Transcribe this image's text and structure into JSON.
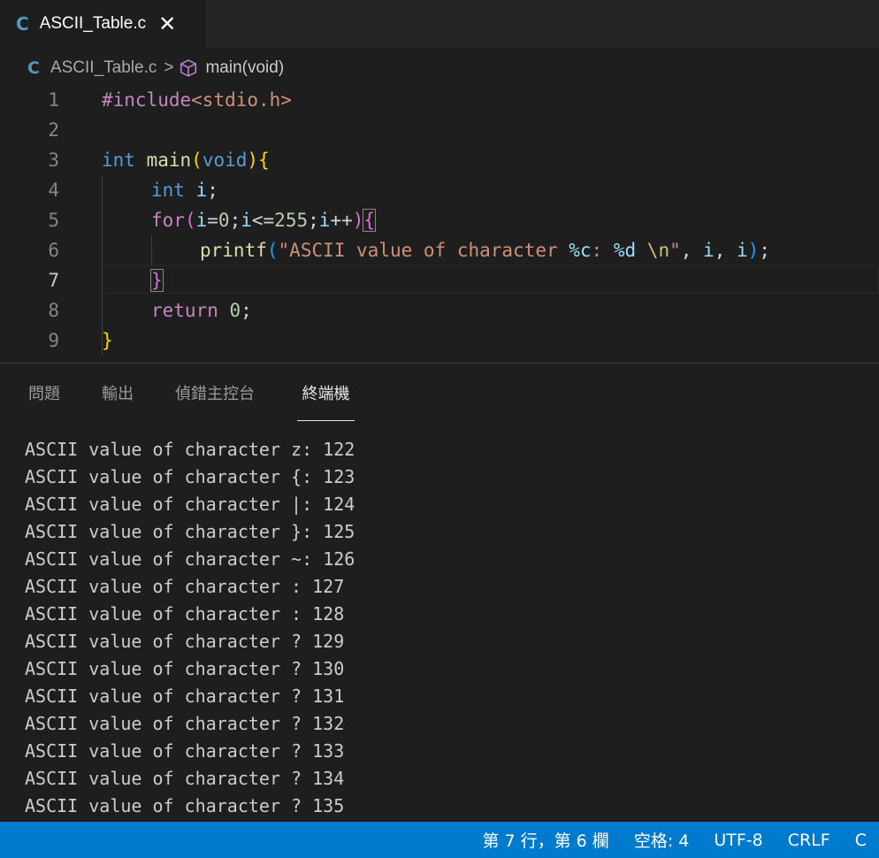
{
  "tab": {
    "title": "ASCII_Table.c",
    "icon": "C",
    "close_glyph": "✕"
  },
  "breadcrumb": {
    "icon": "C",
    "file": "ASCII_Table.c",
    "separator": ">",
    "function": "main(void)"
  },
  "editor": {
    "line_numbers": [
      "1",
      "2",
      "3",
      "4",
      "5",
      "6",
      "7",
      "8",
      "9"
    ],
    "active_line": "7"
  },
  "code": {
    "l1": {
      "directive": "#include",
      "header": "<stdio.h>"
    },
    "l3": {
      "type": "int",
      "name": "main",
      "open": "(",
      "param": "void",
      "close": ")",
      "brace": "{"
    },
    "l4": {
      "type": "int",
      "var": "i",
      "semi": ";"
    },
    "l5": {
      "kw": "for",
      "open": "(",
      "i1": "i",
      "op1": "=",
      "n1": "0",
      "s1": ";",
      "i2": "i",
      "op2": "<=",
      "n2": "255",
      "s2": ";",
      "i3": "i",
      "op3": "++",
      "close": ")",
      "brace": "{"
    },
    "l6": {
      "fn": "printf",
      "open": "(",
      "q1": "\"",
      "text": "ASCII value of character ",
      "f1": "%c",
      "colon": ": ",
      "f2": "%d",
      "space": " ",
      "esc": "\\n",
      "q2": "\"",
      "comma1": ", ",
      "a1": "i",
      "comma2": ", ",
      "a2": "i",
      "close": ")",
      "semi": ";"
    },
    "l7": {
      "brace": "}"
    },
    "l8": {
      "kw": "return",
      "space": " ",
      "num": "0",
      "semi": ";"
    },
    "l9": {
      "brace": "}"
    }
  },
  "panel": {
    "tabs": [
      {
        "label": "問題"
      },
      {
        "label": "輸出"
      },
      {
        "label": "偵錯主控台"
      },
      {
        "label": "終端機"
      }
    ],
    "active_tab": "終端機"
  },
  "terminal": {
    "lines": [
      "ASCII value of character z: 122",
      "ASCII value of character {: 123",
      "ASCII value of character |: 124",
      "ASCII value of character }: 125",
      "ASCII value of character ~: 126",
      "ASCII value of character : 127",
      "ASCII value of character : 128",
      "ASCII value of character ? 129",
      "ASCII value of character ? 130",
      "ASCII value of character ? 131",
      "ASCII value of character ? 132",
      "ASCII value of character ? 133",
      "ASCII value of character ? 134",
      "ASCII value of character ? 135"
    ]
  },
  "statusbar": {
    "position": "第 7 行，第 6 欄",
    "indent": "空格: 4",
    "encoding": "UTF-8",
    "eol": "CRLF",
    "language": "C"
  },
  "colors": {
    "editor_bg": "#1e1e1e",
    "statusbar_bg": "#007acc",
    "keyword": "#569cd6",
    "control": "#c586c0",
    "function": "#dcdcaa",
    "string": "#ce9178",
    "number": "#b5cea8"
  }
}
